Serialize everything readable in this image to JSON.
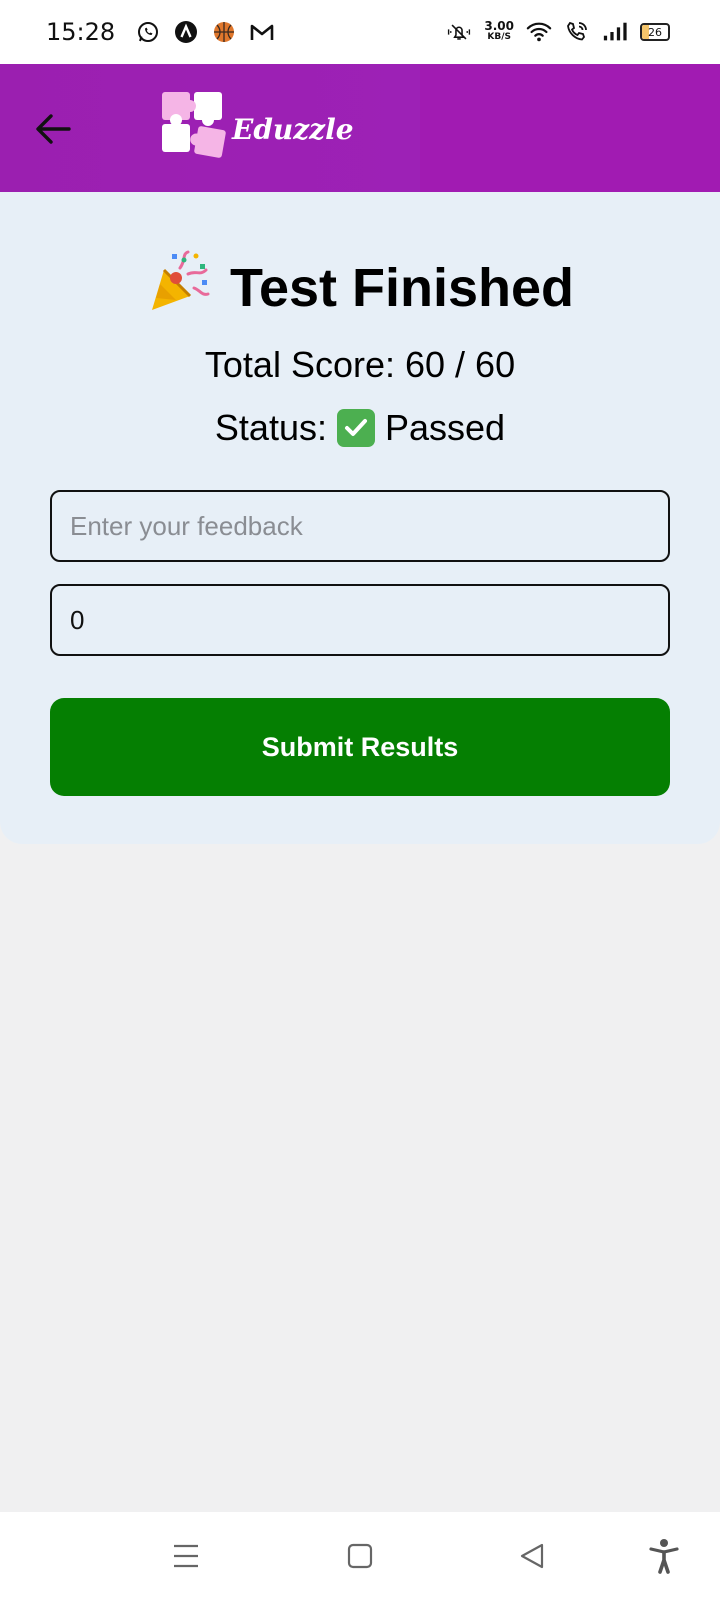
{
  "status_bar": {
    "time": "15:28",
    "net_speed_value": "3.00",
    "net_speed_unit": "KB/S",
    "battery_level": "26",
    "battery_fraction": 0.26,
    "left_icons": [
      "whatsapp-icon",
      "app-a-icon",
      "basketball-icon",
      "gmail-icon"
    ],
    "right_icons": [
      "vibrate-muted-icon",
      "wifi-icon",
      "wifi-calling-icon",
      "signal-icon",
      "battery-icon"
    ]
  },
  "header": {
    "logo_text": "Eduzzle",
    "bg_color": "#9d21b6",
    "back_icon": "arrow-left-icon"
  },
  "result": {
    "title": "Test Finished",
    "title_emoji": "party-popper-icon",
    "score_text": "Total Score: 60 / 60",
    "status_label": "Status:",
    "status_value": "Passed",
    "status_icon": "check-mark-icon"
  },
  "form": {
    "feedback_placeholder": "Enter your feedback",
    "feedback_value": "",
    "score_value": "0",
    "submit_label": "Submit Results",
    "submit_color": "#057f02"
  },
  "nav_bar": {
    "icons": [
      "menu-icon",
      "home-icon",
      "back-icon",
      "accessibility-icon"
    ]
  }
}
